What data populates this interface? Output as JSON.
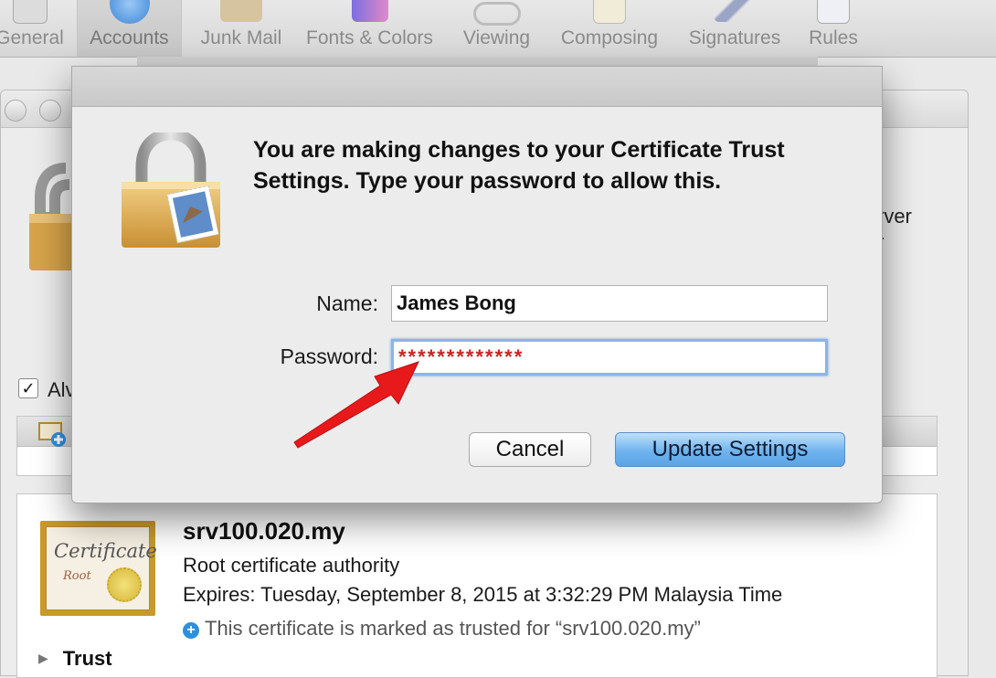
{
  "toolbar": {
    "items": [
      {
        "label": "General"
      },
      {
        "label": "Accounts"
      },
      {
        "label": "Junk Mail"
      },
      {
        "label": "Fonts & Colors"
      },
      {
        "label": "Viewing"
      },
      {
        "label": "Composing"
      },
      {
        "label": "Signatures"
      },
      {
        "label": "Rules"
      }
    ]
  },
  "background": {
    "side_text_1": "rver",
    "side_text_2": "r",
    "checkbox_label": "Alv",
    "certificate": {
      "image_title": "Certificate",
      "image_subtitle": "Root",
      "name": "srv100.020.my",
      "kind": "Root certificate authority",
      "expires": "Expires: Tuesday, September 8, 2015 at 3:32:29 PM Malaysia Time",
      "trust_note": "This certificate is marked as trusted for “srv100.020.my”"
    },
    "trust_section": "Trust"
  },
  "dialog": {
    "message": "You are making changes to your Certificate Trust Settings. Type your password to allow this.",
    "name_label": "Name:",
    "name_value": "James Bong",
    "password_label": "Password:",
    "password_value": "*************",
    "cancel_label": "Cancel",
    "update_label": "Update Settings"
  },
  "colors": {
    "accent_button": "#6fb3ee",
    "password_text": "#cc2222",
    "annotation_arrow": "#e8191b"
  }
}
